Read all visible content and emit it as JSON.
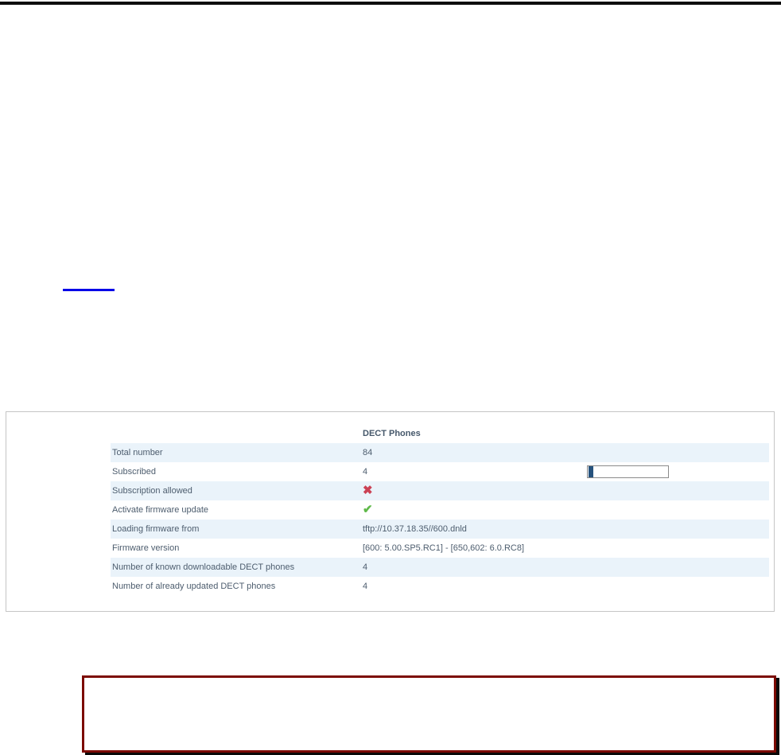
{
  "document": {
    "link": {
      "visible_text": "",
      "underline_color": "#0000e8"
    }
  },
  "figure": {
    "title": "DECT Phones",
    "rows": [
      {
        "label": "Total number",
        "value": "84"
      },
      {
        "label": "Subscribed",
        "value": "4"
      },
      {
        "label": "Subscription allowed",
        "value": "",
        "icon": "cross"
      },
      {
        "label": "Activate firmware update",
        "value": "",
        "icon": "check"
      },
      {
        "label": "Loading firmware from",
        "value": "tftp://10.37.18.35//600.dnld"
      },
      {
        "label": "Firmware version",
        "value": "[600: 5.00.SP5.RC1] - [650,602: 6.0.RC8]"
      },
      {
        "label": "Number of known downloadable DECT phones",
        "value": "4"
      },
      {
        "label": "Number of already updated DECT phones",
        "value": "4"
      }
    ],
    "progress": {
      "value": 4,
      "max": 84,
      "percent": 5
    },
    "icons": {
      "cross": "✖",
      "check": "✔"
    }
  },
  "colors": {
    "top_rule": "#0d0d0d",
    "link_underline": "#0000e8",
    "panel_border": "#c5c5c5",
    "row_alt_background": "#eaf3fa",
    "table_text": "#4d5d6e",
    "progress_fill": "#26527d",
    "cross_icon": "#cb4154",
    "check_icon": "#5fb94a",
    "note_border": "#7c0a02",
    "note_shadow": "#0a0a0a"
  }
}
